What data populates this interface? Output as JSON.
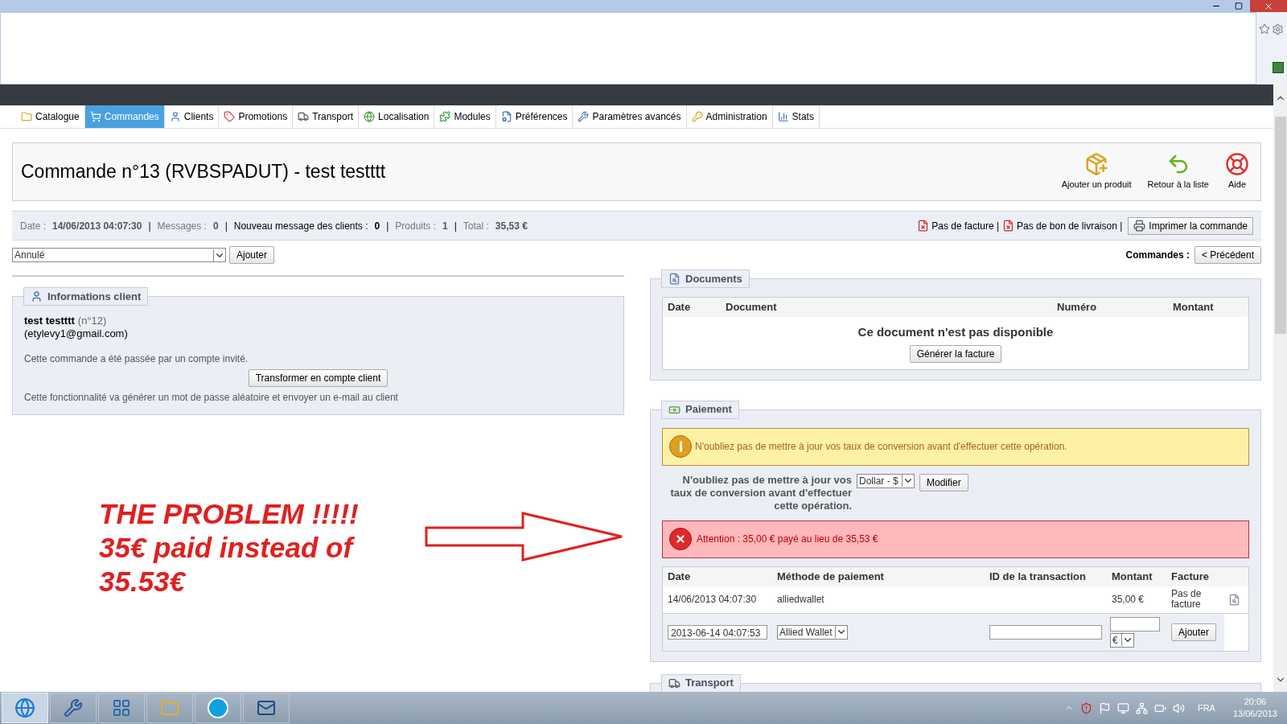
{
  "tabs": [
    {
      "label": "Catalogue",
      "selected": false
    },
    {
      "label": "Commandes",
      "selected": true
    },
    {
      "label": "Clients",
      "selected": false
    },
    {
      "label": "Promotions",
      "selected": false
    },
    {
      "label": "Transport",
      "selected": false
    },
    {
      "label": "Localisation",
      "selected": false
    },
    {
      "label": "Modules",
      "selected": false
    },
    {
      "label": "Préférences",
      "selected": false
    },
    {
      "label": "Paramètres avancés",
      "selected": false
    },
    {
      "label": "Administration",
      "selected": false
    },
    {
      "label": "Stats",
      "selected": false
    }
  ],
  "header": {
    "title": "Commande n°13 (RVBSPADUT) - test testttt",
    "actions": [
      {
        "label": "Ajouter un produit",
        "kind": "add"
      },
      {
        "label": "Retour à la liste",
        "kind": "back"
      },
      {
        "label": "Aide",
        "kind": "help"
      }
    ]
  },
  "summary": {
    "separator": "|",
    "items": [
      {
        "label": "Date :",
        "value": "14/06/2013 04:07:30",
        "emphasis": false
      },
      {
        "label": "Messages :",
        "value": "0",
        "emphasis": false
      },
      {
        "label": "Nouveau message des clients :",
        "value": "0",
        "emphasis": true
      },
      {
        "label": "Produits :",
        "value": "1",
        "emphasis": false
      },
      {
        "label": "Total :",
        "value": "35,53 €",
        "emphasis": false
      }
    ],
    "links": [
      "Pas de facture |",
      "Pas de bon de livraison |"
    ],
    "print_button": "Imprimer la commande"
  },
  "status_form": {
    "value": "Annulé",
    "button": "Ajouter"
  },
  "navigation": {
    "label": "Commandes :",
    "button": "< Précédent"
  },
  "client_panel": {
    "legend": "Informations client",
    "name": "test testttt",
    "number": "(n°12)",
    "email": "(etylevy1@gmail.com)",
    "guest_note": "Cette commande a été passée par un compte invité.",
    "button": "Transformer en compte client",
    "note": "Cette fonctionnalité va générer un mot de passe aléatoire et envoyer un e-mail au client"
  },
  "documents": {
    "legend": "Documents",
    "columns": [
      "Date",
      "Document",
      "Numéro",
      "Montant"
    ],
    "empty": "Ce document n'est pas disponible",
    "button": "Générer la facture"
  },
  "payment": {
    "legend": "Paiement",
    "warning": "N'oubliez pas de mettre à jour vos taux de conversion avant d'effectuer cette opération.",
    "conversion_label": "N'oubliez pas de mettre à jour vos taux de conversion avant d'effectuer cette opération.",
    "currency": "Dollar - $",
    "modify_button": "Modifier",
    "error": "Attention : 35,00 € payé au lieu de 35,53 €",
    "columns": [
      "Date",
      "Méthode de paiement",
      "ID de la transaction",
      "Montant",
      "Facture"
    ],
    "rows": [
      {
        "date": "14/06/2013 04:07:30",
        "method": "alliedwallet",
        "amount": "35,00 €",
        "invoice": "Pas de facture"
      }
    ],
    "new_row": {
      "date": "2013-06-14 04:07:53",
      "method": "Allied Wallet",
      "currency": "€",
      "button": "Ajouter"
    }
  },
  "transport": {
    "legend": "Transport"
  },
  "annotation": {
    "lines": [
      "THE PROBLEM !!!!!",
      "35€ paid instead of",
      "35.53€"
    ]
  },
  "tray": {
    "language": "FRA",
    "time": "20:06",
    "date": "13/06/2013"
  }
}
